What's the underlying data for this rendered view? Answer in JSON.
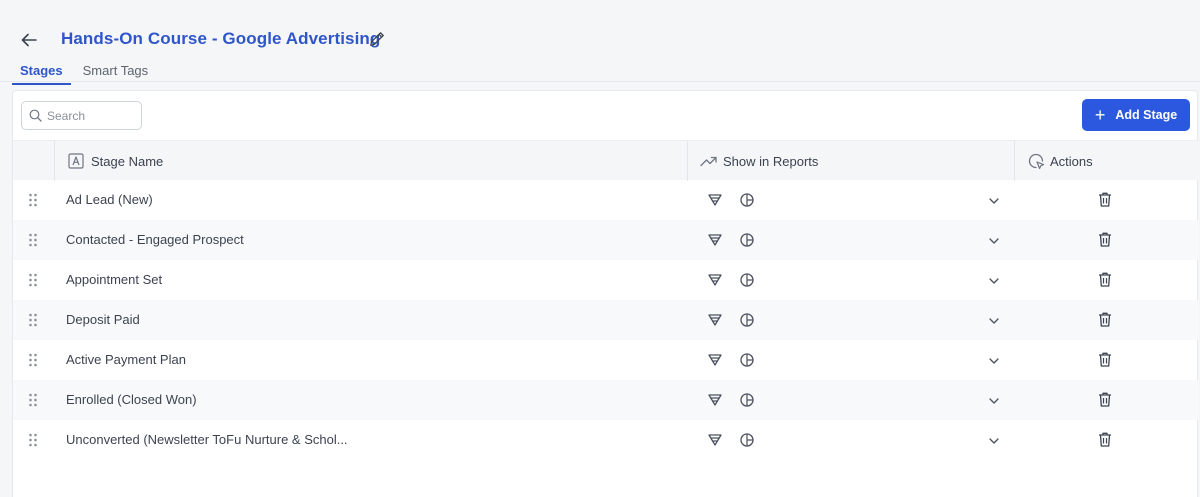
{
  "header": {
    "title": "Hands-On Course - Google Advertising",
    "back_icon": "arrow-left-icon",
    "edit_icon": "pencil-icon"
  },
  "tabs": [
    {
      "label": "Stages",
      "active": true
    },
    {
      "label": "Smart Tags",
      "active": false
    }
  ],
  "toolbar": {
    "search_placeholder": "Search",
    "add_label": "Add Stage"
  },
  "columns": {
    "stage_name": "Stage Name",
    "show_in_reports": "Show in Reports",
    "actions": "Actions"
  },
  "stages": [
    {
      "name": "Ad Lead (New)"
    },
    {
      "name": "Contacted - Engaged Prospect"
    },
    {
      "name": "Appointment Set"
    },
    {
      "name": "Deposit Paid"
    },
    {
      "name": "Active Payment Plan"
    },
    {
      "name": "Enrolled (Closed Won)"
    },
    {
      "name": "Unconverted (Newsletter ToFu Nurture & Schol..."
    }
  ],
  "colors": {
    "accent": "#2f56c9",
    "button": "#2b58df",
    "text": "#3b4350",
    "header_bg": "#f5f6f8"
  }
}
